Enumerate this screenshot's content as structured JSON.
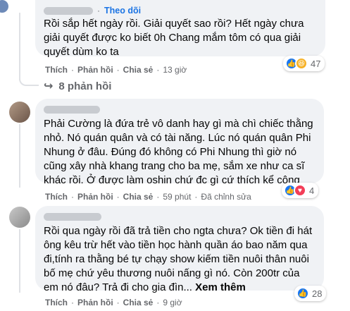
{
  "comment1": {
    "follow_label": "Theo dõi",
    "text": "Rồi sắp hết ngày rồi. Giải quyết sao rồi? Hết ngày chưa\ngiải quyết được ko biết 0h Chang mắm tôm có qua giải\nquyết dùm ko ta",
    "actions": {
      "like": "Thích",
      "reply": "Phản hồi",
      "share": "Chia sẻ",
      "time": "13 giờ"
    },
    "reaction_count": "47",
    "reactions": [
      "like-icon",
      "haha-icon"
    ]
  },
  "replies_toggle": {
    "label": "8 phản hồi"
  },
  "comment2": {
    "text": "Phải Cường là đứa trẻ vô danh hay gì mà chì chiếc thằng\nnhỏ. Nó quán quân và có tài năng. Lúc nó quán quân Phi\nNhung ở đâu. Đúng đó không có Phi Nhung thì giờ nó\ncũng xây nhà khang trang cho ba mẹ, sắm xe như ca sĩ\nkhác rồi. Ở được làm oshin chứ đc gì cứ thích kể công",
    "actions": {
      "like": "Thích",
      "reply": "Phản hồi",
      "share": "Chia sẻ",
      "time": "59 phút",
      "edited": "Đã chỉnh sửa"
    },
    "reaction_count": "4",
    "reactions": [
      "like-icon",
      "heart-icon"
    ]
  },
  "comment3": {
    "text": "Rồi qua ngày rồi đã trả tiền cho ngta chưa? Ok tiền đi hát\nông kêu trừ hết vào tiền học hành quần áo bao năm qua\nđi,tính ra thằng bé tự chạy show kiếm tiền nuôi thân nuôi\nbố mẹ chứ yêu thương nuôi nấng gì nó. Còn 200tr của\nem nó đâu? Trả đi cho gia đìn...",
    "see_more": "Xem thêm",
    "actions": {
      "like": "Thích",
      "reply": "Phản hồi",
      "share": "Chia sẻ",
      "time": "9 giờ"
    },
    "reaction_count": "28",
    "reactions": [
      "like-icon"
    ]
  },
  "colors": {
    "accent": "#1b74e4",
    "bubble": "#f0f2f5",
    "muted": "#65676b",
    "like": "#1877f2",
    "heart": "#f33e58"
  }
}
